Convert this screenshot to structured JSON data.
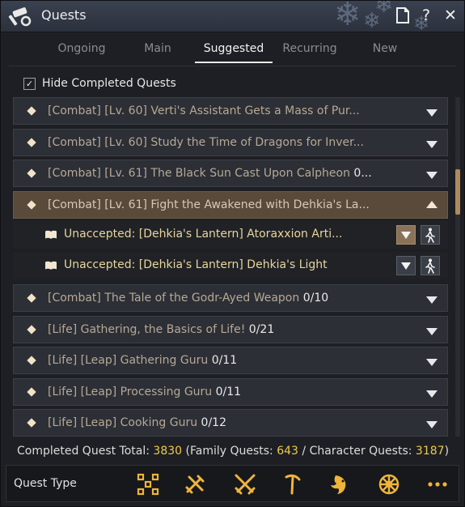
{
  "window": {
    "title": "Quests"
  },
  "tabs": [
    {
      "label": "Ongoing",
      "active": false
    },
    {
      "label": "Main",
      "active": false
    },
    {
      "label": "Suggested",
      "active": true
    },
    {
      "label": "Recurring",
      "active": false
    },
    {
      "label": "New",
      "active": false
    }
  ],
  "filter": {
    "hide_completed_label": "Hide Completed Quests",
    "checked": true
  },
  "quests": [
    {
      "label": "[Combat] [Lv. 60] Verti's Assistant Gets a Mass of Pur...",
      "progress": "",
      "expanded": false
    },
    {
      "label": "[Combat] [Lv. 60] Study the Time of Dragons for Inver...",
      "progress": "",
      "expanded": false
    },
    {
      "label": "[Combat] [Lv. 61] The Black Sun Cast Upon Calpheon",
      "progress": "0...",
      "expanded": false
    },
    {
      "label": "[Combat] [Lv. 61] Fight the Awakened with Dehkia's La...",
      "progress": "",
      "expanded": true,
      "subquests": [
        {
          "label": "Unaccepted: [Dehkia's Lantern] Atoraxxion Arti...",
          "accept_active": true
        },
        {
          "label": "Unaccepted: [Dehkia's Lantern] Dehkia's Light",
          "accept_active": false
        }
      ]
    },
    {
      "label": "[Combat] The Tale of the Godr-Ayed Weapon",
      "progress": "0/10",
      "expanded": false
    },
    {
      "label": "[Life] Gathering, the Basics of Life!",
      "progress": "0/21",
      "expanded": false
    },
    {
      "label": "[Life] [Leap] Gathering Guru",
      "progress": "0/11",
      "expanded": false
    },
    {
      "label": "[Life] [Leap] Processing Guru",
      "progress": "0/11",
      "expanded": false
    },
    {
      "label": "[Life] [Leap] Cooking Guru",
      "progress": "0/12",
      "expanded": false
    }
  ],
  "totals": {
    "label": "Completed Quest Total:",
    "total": "3830",
    "family_label": "(Family Quests:",
    "family": "643",
    "separator": "/",
    "character_label": "Character Quests:",
    "character": "3187",
    "close_paren": ")"
  },
  "footer": {
    "label": "Quest Type",
    "icons": [
      "scatter-squares-icon",
      "crossed-tools-icon",
      "crossed-swords-icon",
      "pickaxe-icon",
      "fish-icon",
      "ship-wheel-icon",
      "more-dots-icon"
    ]
  },
  "colors": {
    "accent_gold": "#efc94b",
    "subquest_text": "#e7d59c",
    "expanded_row": "#5a4a3a"
  }
}
